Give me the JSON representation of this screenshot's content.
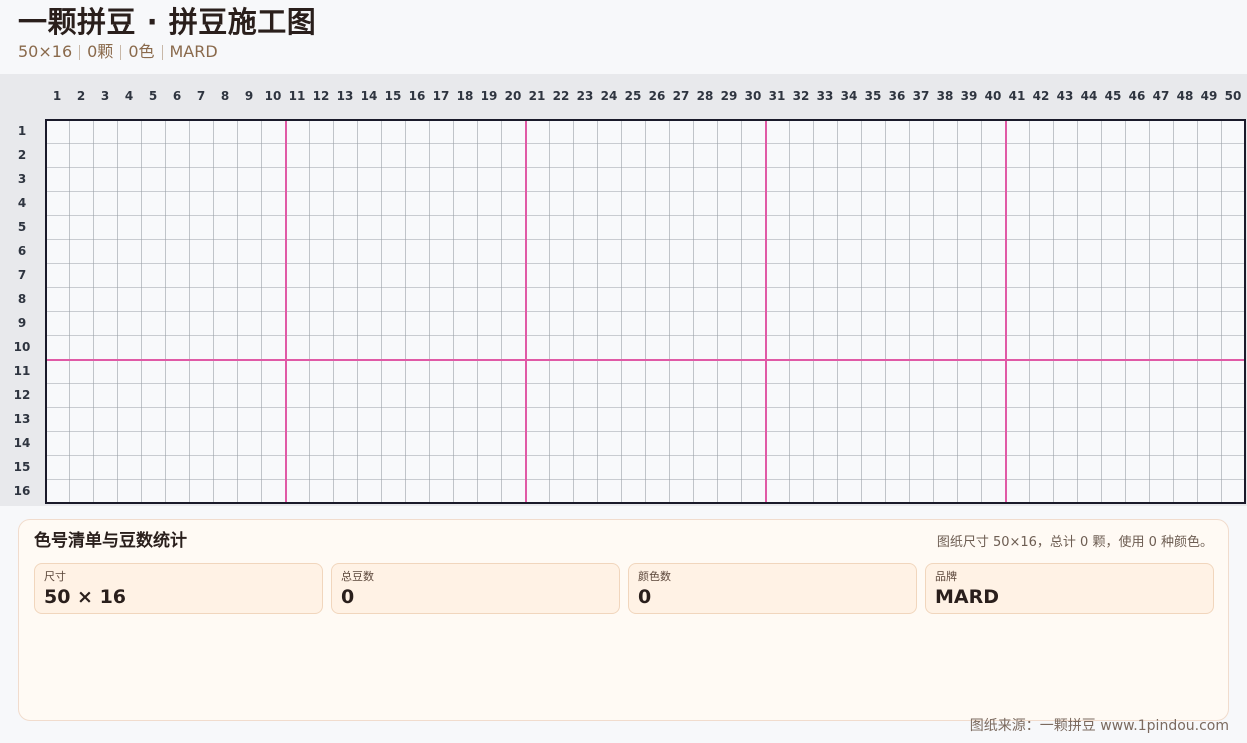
{
  "header": {
    "title": "一颗拼豆 · 拼豆施工图",
    "meta": [
      "50×16",
      "0颗",
      "0色",
      "MARD"
    ]
  },
  "grid": {
    "columns": 50,
    "rows": 16,
    "major_line_every": 10,
    "major_line_color": "#e05aa6",
    "minor_line_color": "#9aa0a8",
    "border_color": "#1a1a2a",
    "cell_color": "#f8f9fb",
    "beads": []
  },
  "panel": {
    "title": "色号清单与豆数统计",
    "summary": "图纸尺寸 50×16，总计 0 颗，使用 0 种颜色。",
    "stats": [
      {
        "label": "尺寸",
        "value": "50 × 16"
      },
      {
        "label": "总豆数",
        "value": "0"
      },
      {
        "label": "颜色数",
        "value": "0"
      },
      {
        "label": "品牌",
        "value": "MARD"
      }
    ]
  },
  "footer": {
    "source": "图纸来源：一颗拼豆 www.1pindou.com"
  }
}
